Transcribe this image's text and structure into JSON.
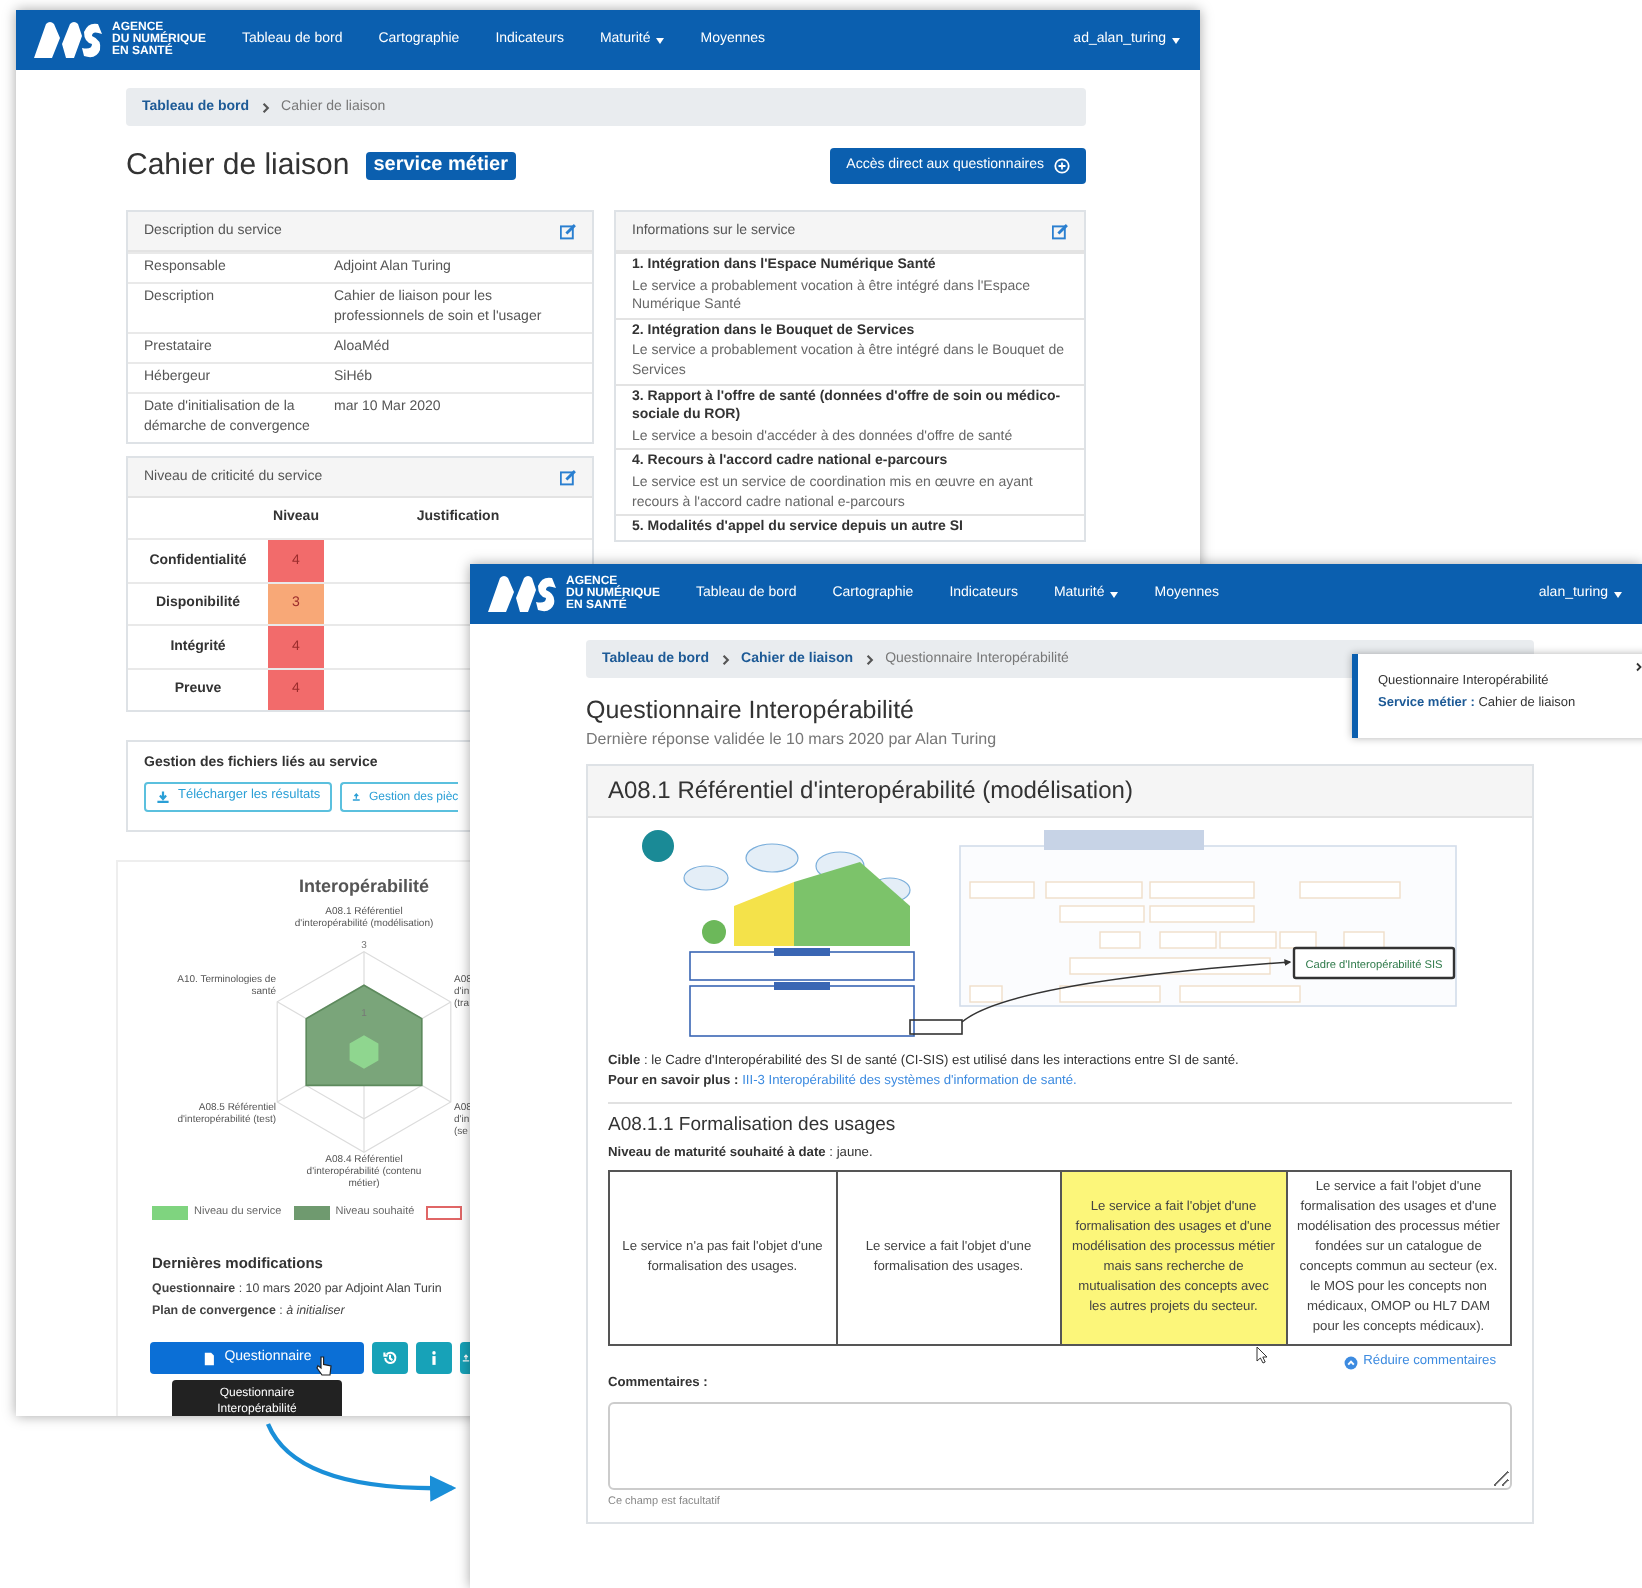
{
  "window_back": {
    "navbar": {
      "brand": [
        "AGENCE",
        "DU NUMÉRIQUE",
        "EN SANTÉ"
      ],
      "items": [
        {
          "label": "Tableau de bord",
          "dropdown": false
        },
        {
          "label": "Cartographie",
          "dropdown": false
        },
        {
          "label": "Indicateurs",
          "dropdown": false
        },
        {
          "label": "Maturité",
          "dropdown": true
        },
        {
          "label": "Moyennes",
          "dropdown": false
        }
      ],
      "user": "ad_alan_turing"
    },
    "breadcrumb": [
      {
        "label": "Tableau de bord",
        "link": true
      },
      {
        "label": "Cahier de liaison",
        "link": false
      }
    ],
    "title": "Cahier de liaison",
    "badge": "service métier",
    "action_button": "Accès direct aux questionnaires",
    "description_card": {
      "title": "Description du service",
      "rows": [
        {
          "label": "Responsable",
          "value": "Adjoint Alan Turing"
        },
        {
          "label": "Description",
          "value": "Cahier de liaison pour les professionnels de soin et l'usager"
        },
        {
          "label": "Prestataire",
          "value": "AloaMéd"
        },
        {
          "label": "Hébergeur",
          "value": "SiHéb"
        },
        {
          "label": "Date d'initialisation de la démarche de convergence",
          "value": "mar 10 Mar 2020"
        }
      ]
    },
    "criticality_card": {
      "title": "Niveau de criticité du service",
      "columns": [
        "Niveau",
        "Justification"
      ],
      "rows": [
        {
          "label": "Confidentialité",
          "value": "4",
          "color": "#f26b6b"
        },
        {
          "label": "Disponibilité",
          "value": "3",
          "color": "#f8a877"
        },
        {
          "label": "Intégrité",
          "value": "4",
          "color": "#f26b6b"
        },
        {
          "label": "Preuve",
          "value": "4",
          "color": "#f26b6b"
        }
      ]
    },
    "info_card": {
      "title": "Informations sur le service",
      "items": [
        {
          "title": "1. Intégration dans l'Espace Numérique Santé",
          "text": "Le service a probablement vocation à être intégré dans l'Espace Numérique Santé"
        },
        {
          "title": "2. Intégration dans le Bouquet de Services",
          "text": "Le service a probablement vocation à être intégré dans le Bouquet de Services"
        },
        {
          "title": "3. Rapport à l'offre de santé (données d'offre de soin ou médico-sociale du ROR)",
          "text": "Le service a besoin d'accéder à des données d'offre de santé"
        },
        {
          "title": "4. Recours à l'accord cadre national e-parcours",
          "text": "Le service est un service de coordination mis en œuvre en ayant recours à l'accord cadre national e-parcours"
        },
        {
          "title": "5. Modalités d'appel du service depuis un autre SI"
        }
      ]
    },
    "files_card": {
      "title": "Gestion des fichiers liés au service",
      "buttons": [
        {
          "label": "Télécharger les résultats",
          "kind": "download"
        },
        {
          "label": "Gestion des pièc",
          "kind": "upload"
        }
      ]
    },
    "chart_card": {
      "title": "Interopérabilité",
      "axis_labels": [
        {
          "text": "A08.1 Référentiel d'interopérabilité (modélisation)",
          "kind": "top"
        },
        {
          "text": "A10. Terminologies de santé",
          "kind": "upper-left"
        },
        {
          "text": "A08.5 Référentiel d'interopérabilité (test)",
          "kind": "lower-left"
        },
        {
          "text": "A08.4 Référentiel d'interopérabilité (contenu métier)",
          "kind": "bottom"
        },
        {
          "text": "A08 d'in (tra",
          "kind": "upper-right"
        },
        {
          "text": "A08 d'in (se",
          "kind": "lower-right"
        }
      ],
      "ticks": [
        "3",
        "1"
      ],
      "legend": [
        {
          "label": "Niveau du service",
          "color": "#7fd47f",
          "outline": false
        },
        {
          "label": "Niveau souhaité",
          "color": "#6f9a6f",
          "outline": false
        },
        {
          "color": "#e06666",
          "outline": true
        }
      ]
    },
    "last_changes": {
      "title": "Dernières modifications",
      "lines": [
        "**Questionnaire** : 10 mars 2020 par Adjoint Alan Turin",
        "**Plan de convergence** : *à initialiser*"
      ]
    },
    "buttons": {
      "primary": "Questionnaire",
      "icons": [
        {
          "kind": "history"
        },
        {
          "kind": "info"
        },
        {
          "kind": "upload"
        }
      ]
    },
    "tooltip": "Questionnaire Interopérabilité"
  },
  "window_front": {
    "navbar": {
      "brand": [
        "AGENCE",
        "DU NUMÉRIQUE",
        "EN SANTÉ"
      ],
      "items": [
        {
          "label": "Tableau de bord",
          "dropdown": false
        },
        {
          "label": "Cartographie",
          "dropdown": false
        },
        {
          "label": "Indicateurs",
          "dropdown": false
        },
        {
          "label": "Maturité",
          "dropdown": true
        },
        {
          "label": "Moyennes",
          "dropdown": false
        }
      ],
      "user": "alan_turing"
    },
    "breadcrumb": [
      {
        "label": "Tableau de bord",
        "link": true
      },
      {
        "label": "Cahier de liaison",
        "link": true
      },
      {
        "label": "Questionnaire Interopérabilité",
        "link": false
      }
    ],
    "popup": {
      "title": "Questionnaire Interopérabilité",
      "label": "Service métier :",
      "value": "Cahier de liaison"
    },
    "title": "Questionnaire Interopérabilité",
    "subtitle": "Dernière réponse validée le 10 mars 2020 par Alan Turing",
    "card": {
      "header": "A08.1 Référentiel d'interopérabilité (modélisation)",
      "diagram": {
        "callout": "Cadre d'Interopérabilité SIS"
      },
      "target": "**Cible** : le Cadre d'Interopérabilité des SI de santé (CI-SIS) est utilisé dans les interactions entre SI de santé.",
      "more": {
        "label": "Pour en savoir plus :",
        "link": "III-3 Interopérabilité des systèmes d'information de santé."
      },
      "subsection": "A08.1.1 Formalisation des usages",
      "expected": "**Niveau de maturité souhaité à date** : jaune.",
      "levels": [
        {
          "text": "Le service n'a pas fait l'objet d'une formalisation des usages.",
          "selected": false
        },
        {
          "text": "Le service a fait l'objet d'une formalisation des usages.",
          "selected": false
        },
        {
          "text": "Le service a fait l'objet d'une formalisation des usages et d'une modélisation des processus métier mais sans recherche de mutualisation des concepts avec les autres projets du secteur.",
          "selected": true
        },
        {
          "text": "Le service a fait l'objet d'une formalisation des usages et d'une modélisation des processus métier fondées sur un catalogue de concepts commun au secteur (ex. le MOS pour les concepts non médicaux, OMOP ou HL7 DAM pour les concepts médicaux).",
          "selected": false
        }
      ],
      "collapse_link": "Réduire commentaires",
      "comments_label": "Commentaires :",
      "comments_help": "Ce champ est facultatif"
    }
  }
}
